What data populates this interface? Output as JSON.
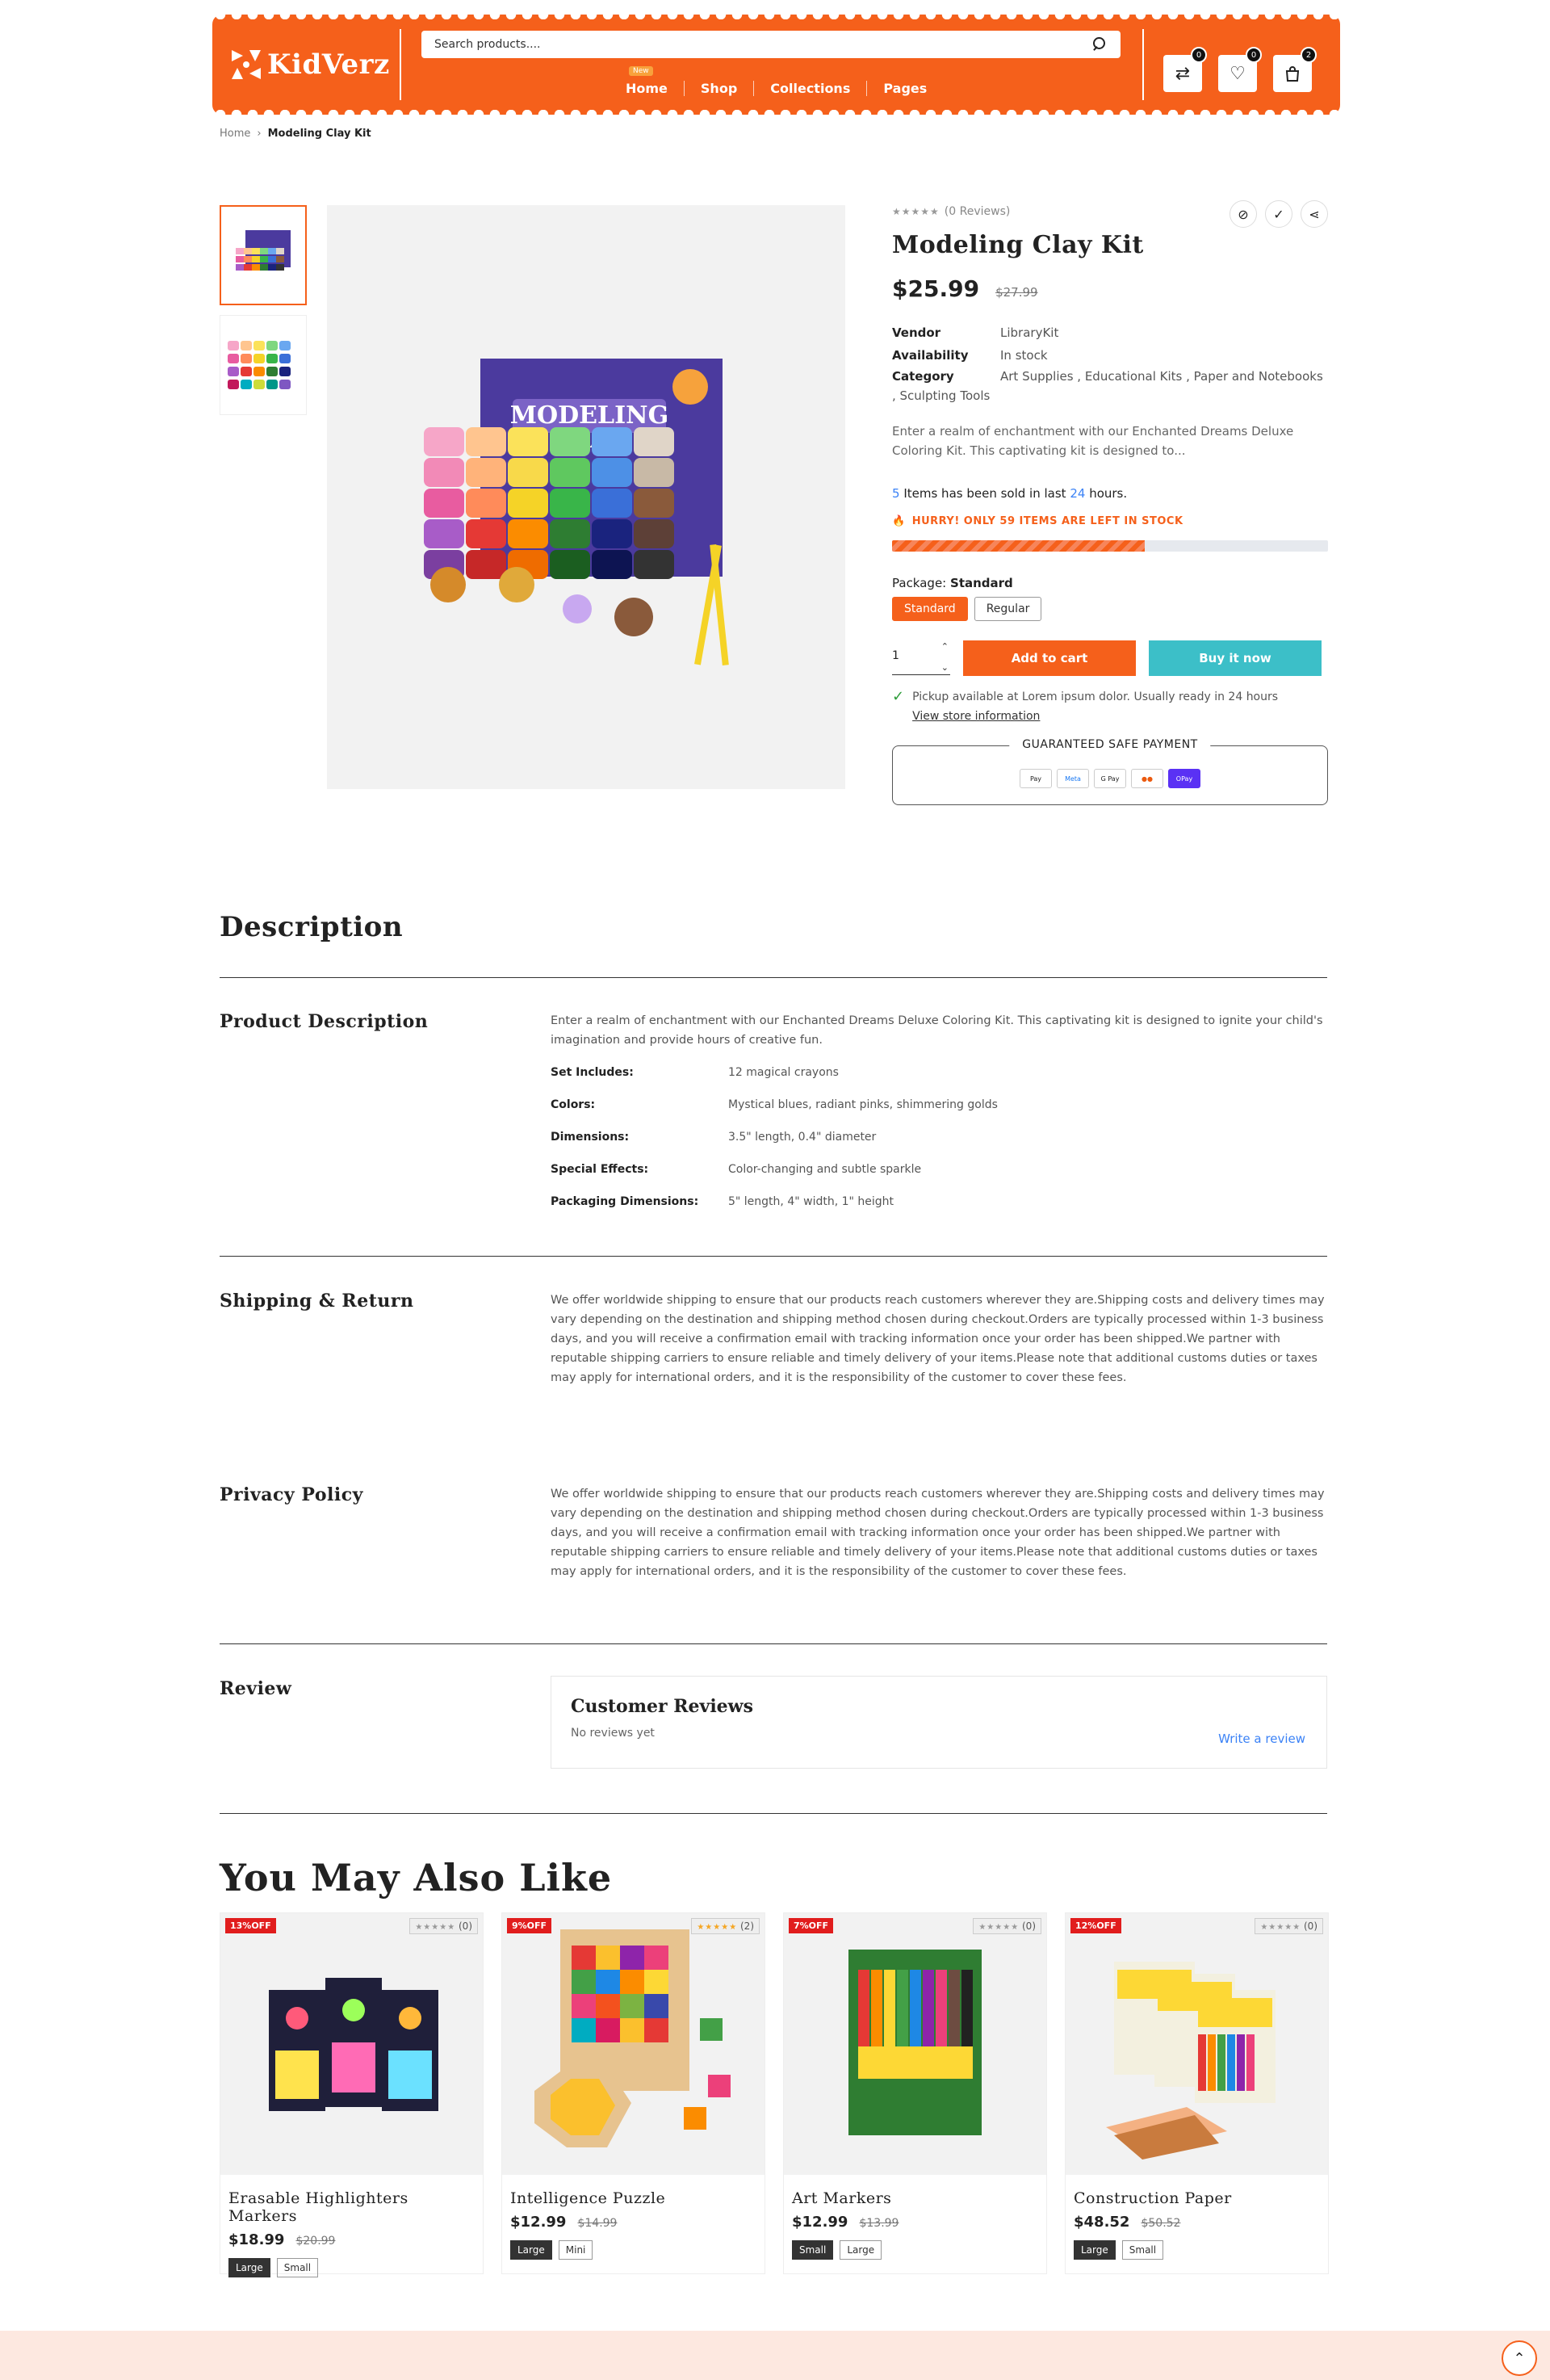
{
  "header": {
    "logo_text": "KidVerz",
    "search_placeholder": "Search products....",
    "nav": [
      {
        "label": "Home",
        "badge": "New"
      },
      {
        "label": "Shop"
      },
      {
        "label": "Collections"
      },
      {
        "label": "Pages"
      }
    ],
    "icons": [
      {
        "name": "compare-icon",
        "glyph": "⇄",
        "count": "0"
      },
      {
        "name": "heart-icon",
        "glyph": "♡",
        "count": "0"
      },
      {
        "name": "bag-icon",
        "glyph": "👜",
        "count": "2"
      }
    ],
    "accent": "#f5601b"
  },
  "breadcrumb": {
    "home": "Home",
    "current": "Modeling Clay Kit"
  },
  "product": {
    "reviews_text": "(0 Reviews)",
    "title": "Modeling Clay Kit",
    "price": "$25.99",
    "compare_price": "$27.99",
    "meta": [
      {
        "label": "Vendor",
        "value": "LibraryKit"
      },
      {
        "label": "Availability",
        "value": "In stock"
      },
      {
        "label": "Category",
        "value": "Art Supplies , Educational Kits , Paper and Notebooks , Sculpting Tools"
      }
    ],
    "excerpt": "Enter a realm of enchantment with our Enchanted Dreams Deluxe Coloring Kit. This captivating kit is designed to...",
    "sold_count": "5",
    "sold_text_a": "Items has been sold in last",
    "sold_hours": "24",
    "sold_text_b": "hours.",
    "hurry_text": "HURRY! ONLY 59 ITEMS ARE LEFT IN STOCK",
    "stock_fraction": 0.58,
    "package_label": "Package:",
    "package_value": "Standard",
    "variants": [
      "Standard",
      "Regular"
    ],
    "quantity": "1",
    "add_to_cart": "Add to cart",
    "buy_now": "Buy it now",
    "pickup_text": "Pickup available at Lorem ipsum dolor. Usually ready in 24 hours",
    "store_link": "View store information",
    "safe_payment": "GUARANTEED SAFE PAYMENT",
    "payments": [
      "Pay",
      "Meta",
      "G Pay",
      "●●",
      "OPay"
    ]
  },
  "description": {
    "title": "Description",
    "product_desc_title": "Product Description",
    "product_desc_text": "Enter a realm of enchantment with our Enchanted Dreams Deluxe Coloring Kit. This captivating kit is designed to ignite your child's imagination and provide hours of creative fun.",
    "specs": [
      {
        "label": "Set Includes:",
        "value": "12 magical crayons"
      },
      {
        "label": "Colors:",
        "value": "Mystical blues, radiant pinks, shimmering golds"
      },
      {
        "label": "Dimensions:",
        "value": "3.5\" length, 0.4\" diameter"
      },
      {
        "label": "Special Effects:",
        "value": "Color-changing and subtle sparkle"
      },
      {
        "label": "Packaging Dimensions:",
        "value": "5\" length, 4\" width, 1\" height"
      }
    ],
    "shipping_title": "Shipping & Return",
    "shipping_text": "We offer worldwide shipping to ensure that our products reach customers wherever they are.Shipping costs and delivery times may vary depending on the destination and shipping method chosen during checkout.Orders are typically processed within 1-3 business days, and you will receive a confirmation email with tracking information once your order has been shipped.We partner with reputable shipping carriers to ensure reliable and timely delivery of your items.Please note that additional customs duties or taxes may apply for international orders, and it is the responsibility of the customer to cover these fees.",
    "privacy_title": "Privacy Policy",
    "privacy_text": "We offer worldwide shipping to ensure that our products reach customers wherever they are.Shipping costs and delivery times may vary depending on the destination and shipping method chosen during checkout.Orders are typically processed within 1-3 business days, and you will receive a confirmation email with tracking information once your order has been shipped.We partner with reputable shipping carriers to ensure reliable and timely delivery of your items.Please note that additional customs duties or taxes may apply for international orders, and it is the responsibility of the customer to cover these fees.",
    "review_title": "Review",
    "customer_reviews": "Customer Reviews",
    "no_reviews": "No reviews yet",
    "write_review": "Write a review"
  },
  "related": {
    "title": "You May Also Like",
    "items": [
      {
        "off": "13%OFF",
        "rating": "(0)",
        "rated": false,
        "name": "Erasable Highlighters Markers",
        "price": "$18.99",
        "compare": "$20.99",
        "variants": [
          "Large",
          "Small"
        ]
      },
      {
        "off": "9%OFF",
        "rating": "(2)",
        "rated": true,
        "name": "Intelligence Puzzle",
        "price": "$12.99",
        "compare": "$14.99",
        "variants": [
          "Large",
          "Mini"
        ]
      },
      {
        "off": "7%OFF",
        "rating": "(0)",
        "rated": false,
        "name": "Art Markers",
        "price": "$12.99",
        "compare": "$13.99",
        "variants": [
          "Small",
          "Large"
        ]
      },
      {
        "off": "12%OFF",
        "rating": "(0)",
        "rated": false,
        "name": "Construction Paper",
        "price": "$48.52",
        "compare": "$50.52",
        "variants": [
          "Large",
          "Small"
        ]
      }
    ]
  }
}
